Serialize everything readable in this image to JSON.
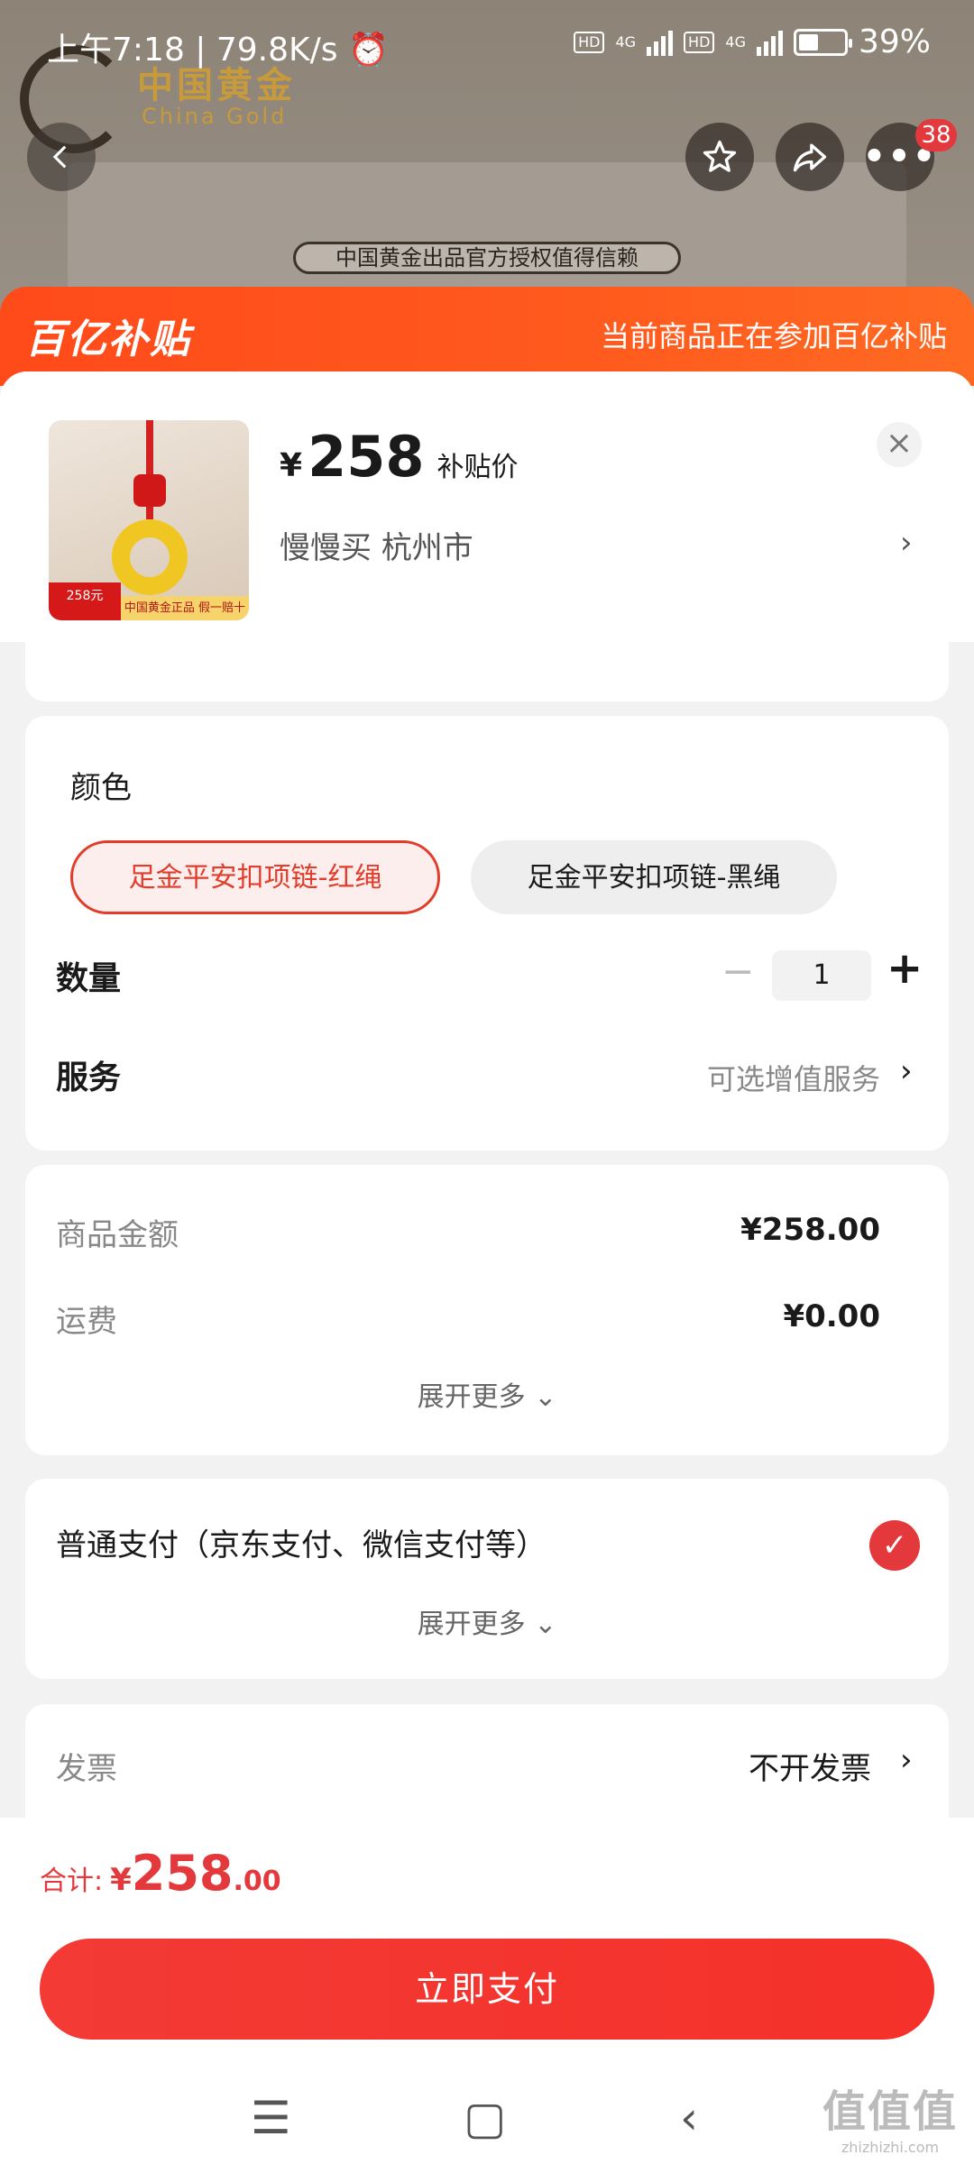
{
  "status_bar": {
    "left_text": "上午7:18 | 79.8K/s",
    "network": "4G",
    "hd_label": "HD",
    "battery_text": "39%",
    "battery_level": 0.39
  },
  "background_page": {
    "brand_name": "中国黄金",
    "brand_sub": "China Gold",
    "auth_banner": "中国黄金出品官方授权值得信赖"
  },
  "top_actions": {
    "more_badge": "38"
  },
  "subsidy": {
    "logo_text": "百亿补贴",
    "notice": "当前商品正在参加百亿补贴"
  },
  "product": {
    "currency": "¥",
    "price": "258",
    "price_tag": "补贴价",
    "address": "慢慢买  杭州市",
    "thumb_badge": "258元",
    "thumb_strip": "中国黄金正品 假一赔十"
  },
  "spec": {
    "color_title": "颜色",
    "options": [
      {
        "label": "足金平安扣项链-红绳",
        "selected": true
      },
      {
        "label": "足金平安扣项链-黑绳",
        "selected": false
      }
    ],
    "quantity_label": "数量",
    "quantity_value": "1",
    "service_label": "服务",
    "service_value": "可选增值服务"
  },
  "amounts": {
    "goods_label": "商品金额",
    "goods_value": "¥258.00",
    "shipping_label": "运费",
    "shipping_value": "¥0.00",
    "expand_label": "展开更多"
  },
  "payment": {
    "method_label": "普通支付（京东支付、微信支付等）",
    "expand_label": "展开更多"
  },
  "invoice": {
    "label": "发票",
    "value": "不开发票"
  },
  "footer": {
    "total_label": "合计:",
    "total_currency": "¥",
    "total_int": "258",
    "total_dec": ".00",
    "pay_button": "立即支付"
  },
  "watermark": {
    "big": "值值值",
    "small": "zhizhizhi.com"
  },
  "colors": {
    "accent": "#e4393c",
    "subsidy_orange": "#ff4a1a"
  }
}
